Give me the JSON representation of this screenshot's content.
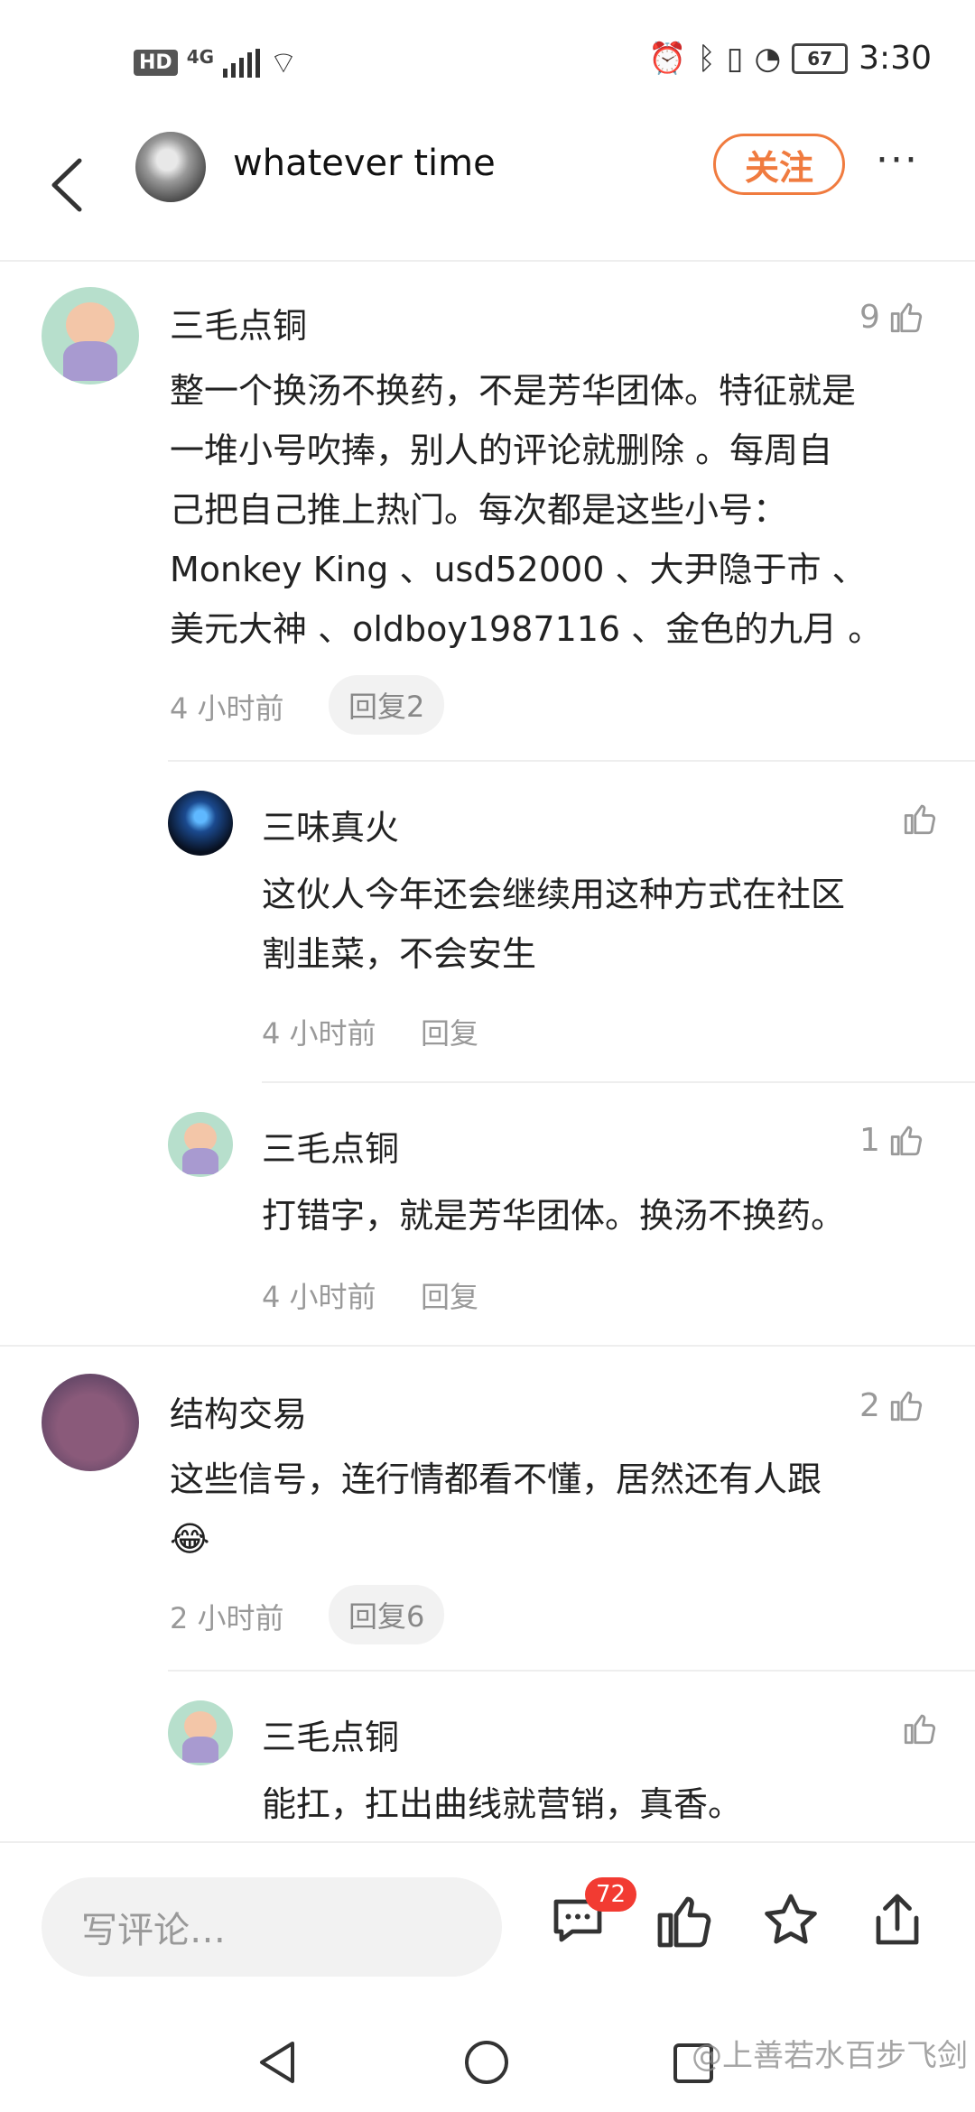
{
  "status_bar": {
    "hd": "HD",
    "network": "4G",
    "battery": "67",
    "time": "3:30"
  },
  "header": {
    "author_name": "whatever time",
    "follow_label": "关注",
    "more_label": "···"
  },
  "comments": [
    {
      "user": "三毛点铜",
      "likes": "9",
      "text": [
        "整一个换汤不换药，不是芳华团体。特征就是",
        "一堆小号吹捧，别人的评论就删除 。每周自",
        "己把自己推上热门。每次都是这些小号：",
        "Monkey King 、usd52000 、大尹隐于市 、",
        "美元大神 、oldboy1987116 、金色的九月 。"
      ],
      "time": "4 小时前",
      "reply_label": "回复2",
      "replies": [
        {
          "user": "三味真火",
          "likes": "",
          "text": [
            "这伙人今年还会继续用这种方式在社区",
            "割韭菜，不会安生"
          ],
          "time": "4 小时前",
          "reply_label": "回复"
        },
        {
          "user": "三毛点铜",
          "likes": "1",
          "text": [
            "打错字，就是芳华团体。换汤不换药。"
          ],
          "time": "4 小时前",
          "reply_label": "回复"
        }
      ]
    },
    {
      "user": "结构交易",
      "likes": "2",
      "text": [
        "这些信号，连行情都看不懂，居然还有人跟",
        "😂"
      ],
      "time": "2 小时前",
      "reply_label": "回复6",
      "replies": [
        {
          "user": "三毛点铜",
          "likes": "",
          "text": [
            "能扛，扛出曲线就营销，真香。"
          ]
        }
      ]
    }
  ],
  "bottom_bar": {
    "input_placeholder": "写评论…",
    "comment_count": "72"
  },
  "watermark": "@上善若水百步飞剑",
  "colors": {
    "accent": "#f07b3f",
    "badge": "#f23b32",
    "muted": "#999999"
  }
}
